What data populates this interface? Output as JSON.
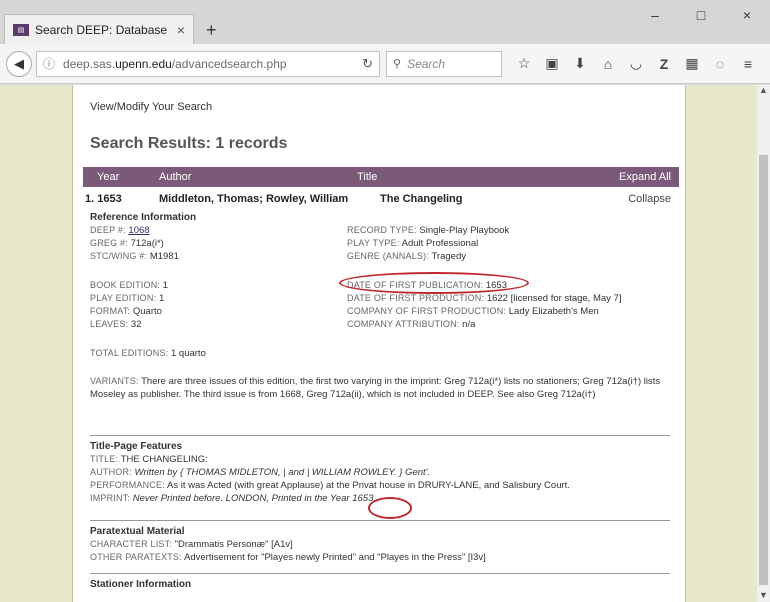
{
  "browser": {
    "tab_title": "Search DEEP: Database of ...",
    "tab_close": "×",
    "new_tab": "+",
    "url_prefix": "deep.sas.",
    "url_domain": "upenn.edu",
    "url_path": "/advancedsearch.php",
    "search_placeholder": "Search",
    "window_min": "–",
    "window_max": "□",
    "window_close": "×"
  },
  "page": {
    "modify_link": "View/Modify Your Search",
    "results_heading": "Search Results: 1 records",
    "header": {
      "year": "Year",
      "author": "Author",
      "title": "Title",
      "expand_all": "Expand All"
    },
    "record": {
      "number_year": "1. 1653",
      "author": "Middleton, Thomas; Rowley, William",
      "title": "The Changeling",
      "collapse": "Collapse"
    },
    "reference": {
      "section_title": "Reference Information",
      "deep_label": "DEEP #:",
      "deep_value": "1068",
      "greg_label": "GREG #:",
      "greg_value": "712a(i*)",
      "stc_label": "STC/WING #:",
      "stc_value": "M1981",
      "record_type_label": "RECORD TYPE:",
      "record_type_value": "Single-Play Playbook",
      "play_type_label": "PLAY TYPE:",
      "play_type_value": "Adult Professional",
      "genre_label": "GENRE (ANNALS):",
      "genre_value": "Tragedy",
      "book_edition_label": "BOOK EDITION:",
      "book_edition_value": "1",
      "play_edition_label": "PLAY EDITION:",
      "play_edition_value": "1",
      "format_label": "FORMAT:",
      "format_value": "Quarto",
      "leaves_label": "LEAVES:",
      "leaves_value": "32",
      "first_pub_label": "DATE OF FIRST PUBLICATION:",
      "first_pub_value": "1653",
      "first_prod_label": "DATE OF FIRST PRODUCTION:",
      "first_prod_value": "1622 [licensed for stage, May 7]",
      "company_label": "COMPANY OF FIRST PRODUCTION:",
      "company_value": "Lady Elizabeth's Men",
      "attribution_label": "COMPANY ATTRIBUTION:",
      "attribution_value": "n/a",
      "total_editions_label": "TOTAL EDITIONS:",
      "total_editions_value": "1 quarto",
      "variants_label": "VARIANTS:",
      "variants_value": "There are three issues of this edition, the first two varying in the imprint: Greg 712a(i*) lists no stationers; Greg 712a(i†) lists Moseley as publisher. The third issue is from 1668, Greg 712a(ii), which is not included in DEEP. See also Greg 712a(i†)"
    },
    "title_page": {
      "section_title": "Title-Page Features",
      "title_label": "TITLE:",
      "title_value": "THE CHANGELING:",
      "author_label": "AUTHOR:",
      "author_value": "Written by { THOMAS MIDLETON, | and | WILLIAM ROWLEY. } Gent'.",
      "performance_label": "PERFORMANCE:",
      "performance_value": "As it was Acted (with great Applause) at the Privat house in DRURY-LANE, and Salisbury Court.",
      "imprint_label": "IMPRINT:",
      "imprint_value": "Never Printed before. LONDON, Printed in the Year 1653."
    },
    "paratextual": {
      "section_title": "Paratextual Material",
      "character_label": "CHARACTER LIST:",
      "character_value": "\"Drammatis Personæ\" [A1v]",
      "other_label": "OTHER PARATEXTS:",
      "other_value": "Advertisement for \"Playes newly Printed\" and \"Playes in the Press\" [I3v]"
    },
    "stationer": {
      "section_title": "Stationer Information"
    }
  },
  "colors": {
    "header_bg": "#7a5a78",
    "page_bg": "#e6e8c9",
    "annotation": "#c0262c"
  }
}
